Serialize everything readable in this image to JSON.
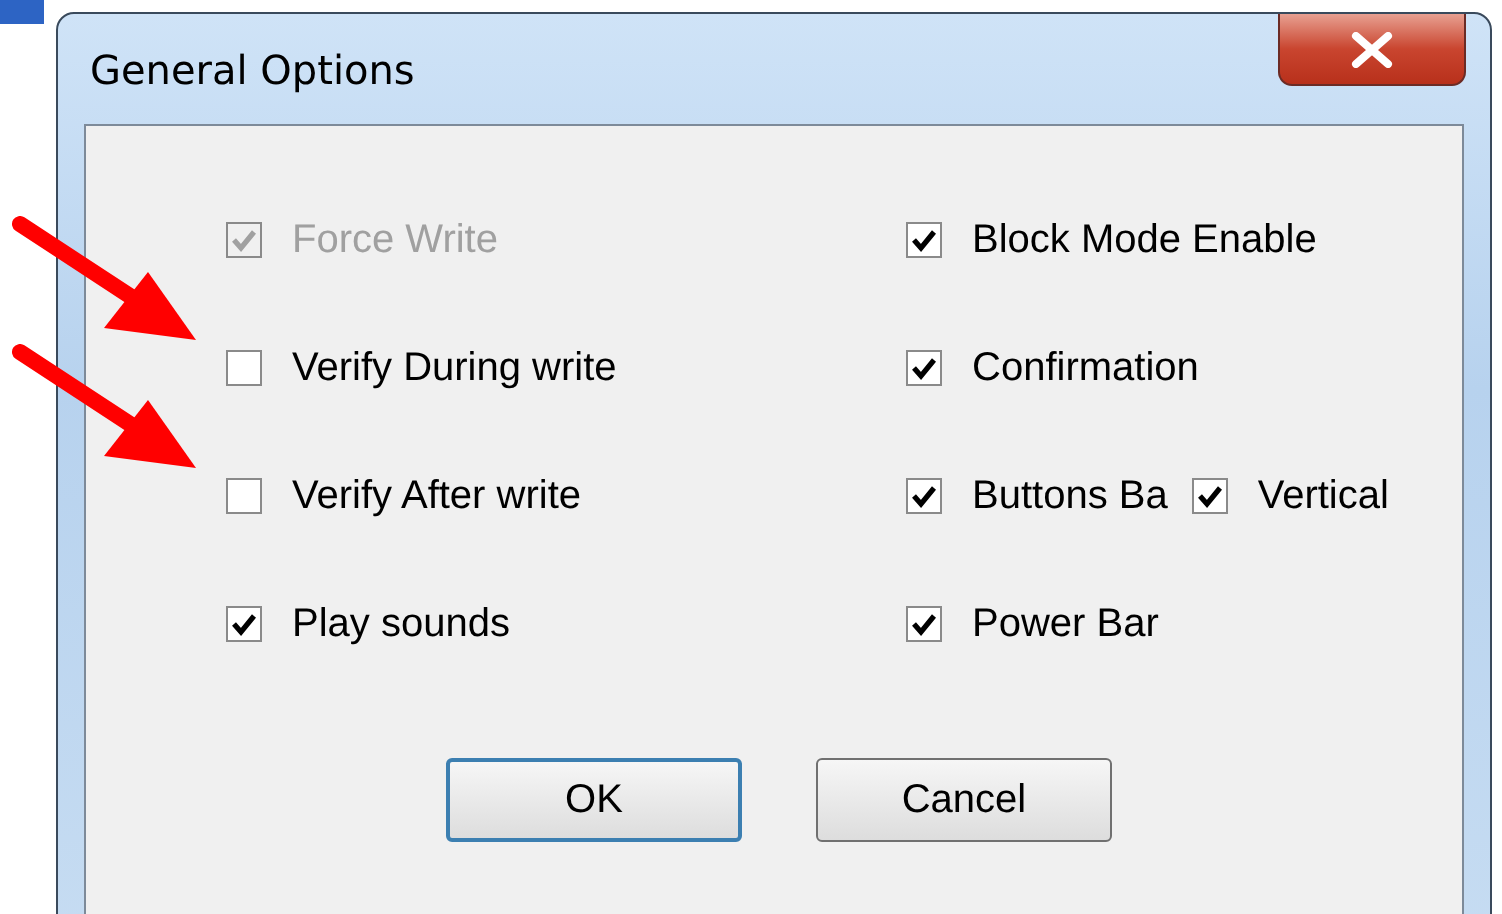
{
  "window": {
    "title": "General Options"
  },
  "left_options": [
    {
      "label": "Force Write",
      "checked": true,
      "disabled": true
    },
    {
      "label": "Verify During write",
      "checked": false,
      "disabled": false
    },
    {
      "label": "Verify After write",
      "checked": false,
      "disabled": false
    },
    {
      "label": "Play sounds",
      "checked": true,
      "disabled": false
    }
  ],
  "right_options": [
    {
      "label": "Block Mode Enable",
      "checked": true,
      "disabled": false
    },
    {
      "label": "Confirmation",
      "checked": true,
      "disabled": false
    },
    {
      "label": "Buttons Ba",
      "checked": true,
      "disabled": false,
      "inline": {
        "label": "Vertical",
        "checked": true,
        "disabled": false
      }
    },
    {
      "label": "Power Bar",
      "checked": true,
      "disabled": false
    }
  ],
  "buttons": [
    "OK",
    "Cancel"
  ],
  "annotations": [
    {
      "kind": "arrow",
      "color": "#ff0000"
    },
    {
      "kind": "arrow",
      "color": "#ff0000"
    }
  ]
}
